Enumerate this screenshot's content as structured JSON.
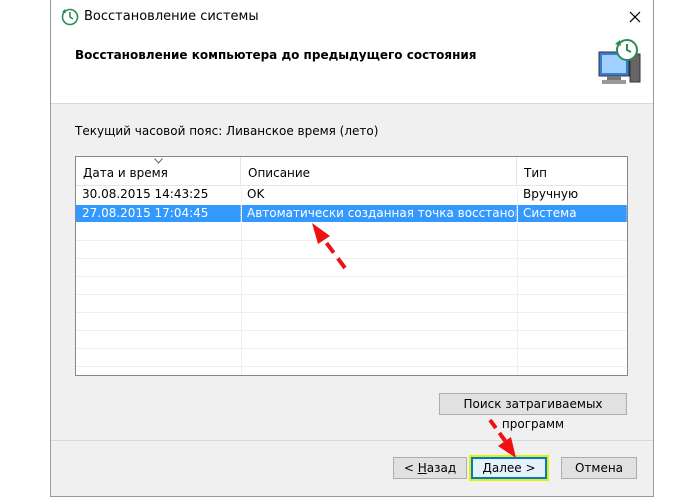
{
  "window": {
    "title": "Восстановление системы",
    "heading": "Восстановление компьютера до предыдущего состояния"
  },
  "timezone_label": "Текущий часовой пояс: Ливанское время (лето)",
  "table": {
    "columns": [
      "Дата и время",
      "Описание",
      "Тип"
    ],
    "rows": [
      {
        "date": "30.08.2015 14:43:25",
        "description": "OK",
        "type": "Вручную",
        "selected": false
      },
      {
        "date": "27.08.2015 17:04:45",
        "description": "Автоматически созданная точка восстановле…",
        "type": "Система",
        "selected": true
      }
    ]
  },
  "buttons": {
    "search": "Поиск затрагиваемых программ",
    "back": "< Назад",
    "next": "Далее >",
    "cancel": "Отмена"
  },
  "colors": {
    "selection": "#3399ff",
    "annotation_arrow": "#ee1111",
    "highlight": "#e4f000"
  }
}
